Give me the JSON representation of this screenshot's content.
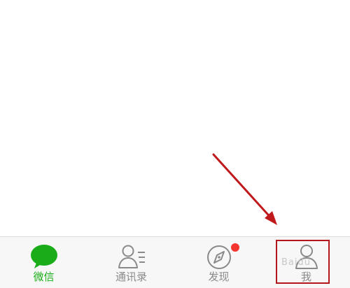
{
  "tabbar": {
    "tabs": [
      {
        "label": "微信",
        "icon": "chat-bubble-icon",
        "active": true
      },
      {
        "label": "通讯录",
        "icon": "contacts-icon",
        "active": false
      },
      {
        "label": "发现",
        "icon": "compass-icon",
        "active": false,
        "badge": "red-dot"
      },
      {
        "label": "我",
        "icon": "person-icon",
        "active": false
      }
    ]
  },
  "colors": {
    "active": "#1aad19",
    "inactive": "#8a8a8a",
    "badge": "#f43530",
    "annotation": "#b3171b"
  },
  "watermark": {
    "text": "Baidu"
  }
}
